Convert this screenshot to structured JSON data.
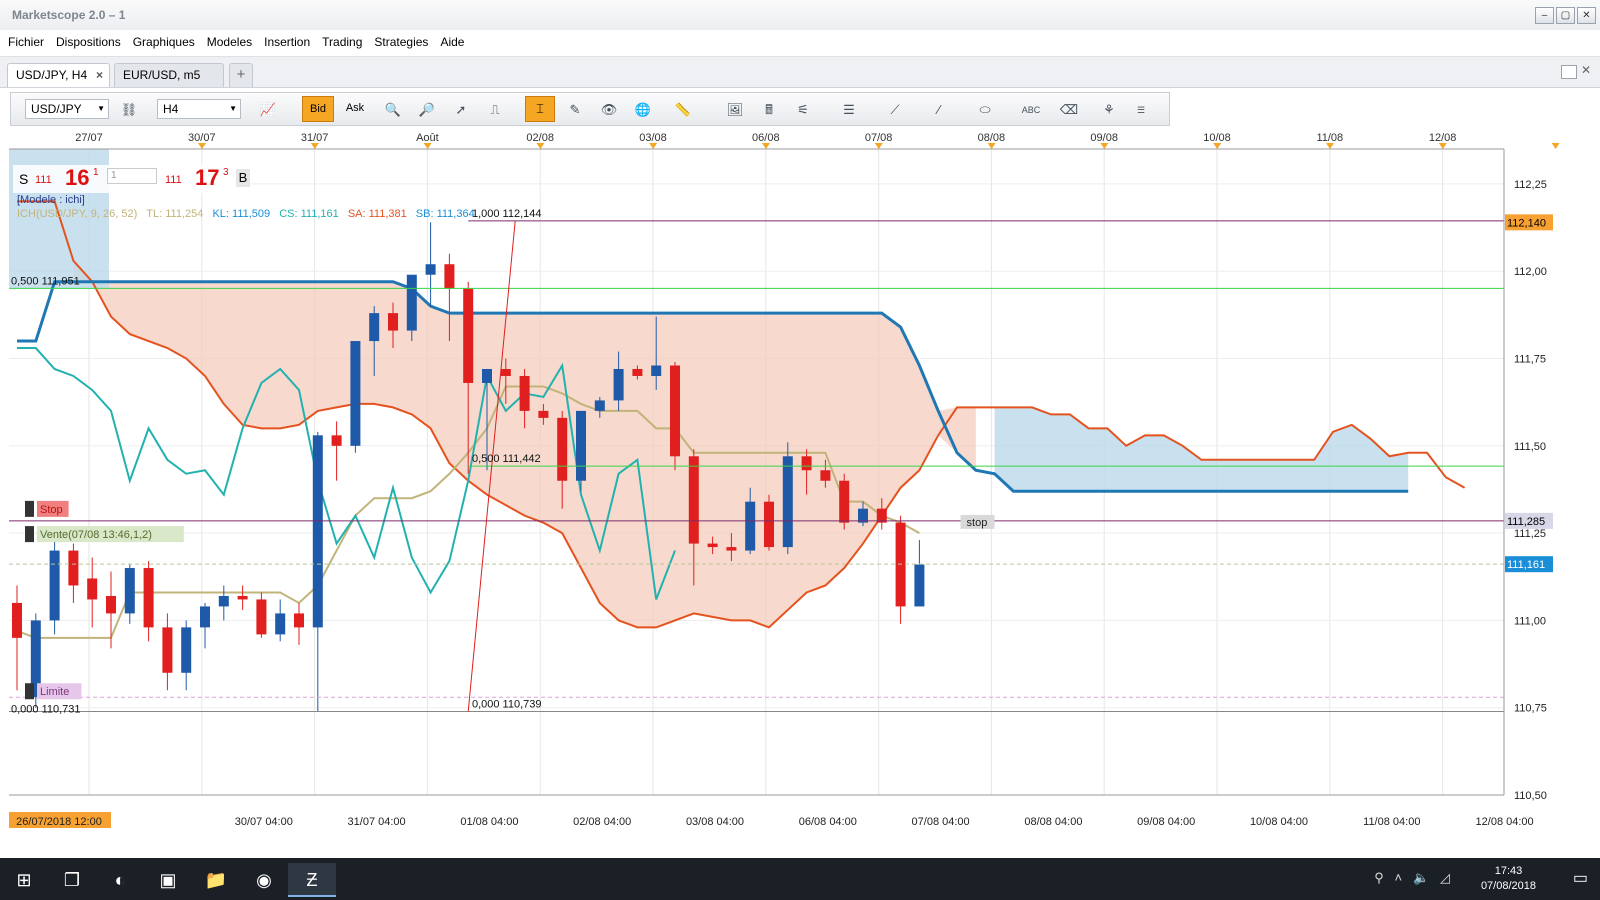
{
  "window": {
    "title": "Marketscope 2.0 – 1"
  },
  "menu": [
    "Fichier",
    "Dispositions",
    "Graphiques",
    "Modeles",
    "Insertion",
    "Trading",
    "Strategies",
    "Aide"
  ],
  "tabs": [
    {
      "label": "USD/JPY, H4",
      "active": true,
      "close": "×"
    },
    {
      "label": "EUR/USD, m5",
      "active": false
    }
  ],
  "add_tab": "+",
  "toolbar": {
    "instrument": "USD/JPY",
    "timeframe": "H4",
    "bid": "Bid",
    "ask": "Ask"
  },
  "quote": {
    "sell_label": "S",
    "sell_big": "111",
    "sell_pips": "16",
    "sell_frac": "1",
    "amount": "1",
    "buy_big": "111",
    "buy_pips": "17",
    "buy_frac": "3",
    "buy_label": "B"
  },
  "template_label": "[Modele : ichi]",
  "indicator": {
    "name": "ICH(USD/JPY, 9, 26, 52)",
    "tl": "TL: 111,254",
    "kl": "KL: 111,509",
    "cs": "CS: 111,161",
    "sa": "SA: 111,381",
    "sb": "SB: 111,364"
  },
  "date_axis_top": [
    "27/07",
    "30/07",
    "31/07",
    "Août",
    "02/08",
    "03/08",
    "06/08",
    "07/08",
    "08/08",
    "09/08",
    "10/08",
    "11/08",
    "12/08"
  ],
  "date_axis_bottom": [
    "26/07/2018 12:00",
    "30/07 04:00",
    "31/07 04:00",
    "01/08 04:00",
    "02/08 04:00",
    "03/08 04:00",
    "06/08 04:00",
    "07/08 04:00",
    "08/08 04:00",
    "09/08 04:00",
    "10/08 04:00",
    "11/08 04:00",
    "12/08 04:00"
  ],
  "price_axis": [
    "112,25",
    "112,00",
    "111,75",
    "111,50",
    "111,25",
    "111,00",
    "110,75",
    "110,50"
  ],
  "price_tags": [
    {
      "label": "112,140",
      "value": 112.14
    },
    {
      "label": "111,285",
      "value": 111.285
    },
    {
      "label": "111,161",
      "value": 111.161
    }
  ],
  "fib_labels": [
    "1,000 112,144",
    "0,500 111,442",
    "0,000 110,739",
    "0,500 111,951",
    "0,000 110,731"
  ],
  "order_labels": {
    "stop": "Stop",
    "vente": "Vente(07/08 13:46,1,2)",
    "limite": "Limite",
    "stop_small": "stop"
  },
  "colors": {
    "bull": "#1e5aa8",
    "bear": "#e11f1f",
    "kijun": "#1f77b4",
    "tenkan": "#c2b37a",
    "senkou_a": "#e4531f",
    "chikou": "#21b2b0",
    "cloud_bear": "#f4c9b8",
    "cloud_bull": "#bcd9ea",
    "fib_green": "#3ad44a",
    "fib_purple": "#7b2b6b",
    "tag_orange": "#f7a133",
    "tag_blue": "#1a8fd8"
  },
  "chart_data": {
    "type": "candlestick",
    "instrument": "USD/JPY",
    "timeframe": "H4",
    "ylim": [
      110.5,
      112.35
    ],
    "candles": [
      {
        "o": 111.05,
        "h": 111.1,
        "l": 110.8,
        "c": 110.95
      },
      {
        "o": 110.78,
        "h": 111.02,
        "l": 110.75,
        "c": 111.0
      },
      {
        "o": 111.0,
        "h": 111.23,
        "l": 110.96,
        "c": 111.2
      },
      {
        "o": 111.2,
        "h": 111.22,
        "l": 111.05,
        "c": 111.1
      },
      {
        "o": 111.12,
        "h": 111.18,
        "l": 110.98,
        "c": 111.06
      },
      {
        "o": 111.07,
        "h": 111.14,
        "l": 110.92,
        "c": 111.02
      },
      {
        "o": 111.02,
        "h": 111.16,
        "l": 110.99,
        "c": 111.15
      },
      {
        "o": 111.15,
        "h": 111.17,
        "l": 110.94,
        "c": 110.98
      },
      {
        "o": 110.98,
        "h": 111.02,
        "l": 110.8,
        "c": 110.85
      },
      {
        "o": 110.85,
        "h": 111.0,
        "l": 110.8,
        "c": 110.98
      },
      {
        "o": 110.98,
        "h": 111.05,
        "l": 110.92,
        "c": 111.04
      },
      {
        "o": 111.04,
        "h": 111.1,
        "l": 111.0,
        "c": 111.07
      },
      {
        "o": 111.07,
        "h": 111.1,
        "l": 111.03,
        "c": 111.06
      },
      {
        "o": 111.06,
        "h": 111.08,
        "l": 110.95,
        "c": 110.96
      },
      {
        "o": 110.96,
        "h": 111.06,
        "l": 110.94,
        "c": 111.02
      },
      {
        "o": 111.02,
        "h": 111.05,
        "l": 110.93,
        "c": 110.98
      },
      {
        "o": 110.98,
        "h": 111.54,
        "l": 110.74,
        "c": 111.53
      },
      {
        "o": 111.53,
        "h": 111.57,
        "l": 111.4,
        "c": 111.5
      },
      {
        "o": 111.5,
        "h": 111.62,
        "l": 111.48,
        "c": 111.8
      },
      {
        "o": 111.8,
        "h": 111.9,
        "l": 111.7,
        "c": 111.88
      },
      {
        "o": 111.88,
        "h": 111.91,
        "l": 111.78,
        "c": 111.83
      },
      {
        "o": 111.83,
        "h": 111.98,
        "l": 111.8,
        "c": 111.99
      },
      {
        "o": 111.99,
        "h": 112.14,
        "l": 111.9,
        "c": 112.02
      },
      {
        "o": 112.02,
        "h": 112.05,
        "l": 111.8,
        "c": 111.95
      },
      {
        "o": 111.95,
        "h": 111.97,
        "l": 111.42,
        "c": 111.68
      },
      {
        "o": 111.68,
        "h": 111.72,
        "l": 111.43,
        "c": 111.72
      },
      {
        "o": 111.72,
        "h": 111.75,
        "l": 111.62,
        "c": 111.7
      },
      {
        "o": 111.7,
        "h": 111.72,
        "l": 111.55,
        "c": 111.6
      },
      {
        "o": 111.6,
        "h": 111.62,
        "l": 111.56,
        "c": 111.58
      },
      {
        "o": 111.58,
        "h": 111.6,
        "l": 111.32,
        "c": 111.4
      },
      {
        "o": 111.4,
        "h": 111.55,
        "l": 111.37,
        "c": 111.6
      },
      {
        "o": 111.6,
        "h": 111.64,
        "l": 111.58,
        "c": 111.63
      },
      {
        "o": 111.63,
        "h": 111.77,
        "l": 111.6,
        "c": 111.72
      },
      {
        "o": 111.72,
        "h": 111.73,
        "l": 111.69,
        "c": 111.7
      },
      {
        "o": 111.7,
        "h": 111.87,
        "l": 111.66,
        "c": 111.73
      },
      {
        "o": 111.73,
        "h": 111.74,
        "l": 111.43,
        "c": 111.47
      },
      {
        "o": 111.47,
        "h": 111.49,
        "l": 111.1,
        "c": 111.22
      },
      {
        "o": 111.22,
        "h": 111.24,
        "l": 111.19,
        "c": 111.21
      },
      {
        "o": 111.21,
        "h": 111.25,
        "l": 111.17,
        "c": 111.2
      },
      {
        "o": 111.2,
        "h": 111.38,
        "l": 111.19,
        "c": 111.34
      },
      {
        "o": 111.34,
        "h": 111.36,
        "l": 111.2,
        "c": 111.21
      },
      {
        "o": 111.21,
        "h": 111.51,
        "l": 111.19,
        "c": 111.47
      },
      {
        "o": 111.47,
        "h": 111.49,
        "l": 111.36,
        "c": 111.43
      },
      {
        "o": 111.43,
        "h": 111.46,
        "l": 111.38,
        "c": 111.4
      },
      {
        "o": 111.4,
        "h": 111.42,
        "l": 111.26,
        "c": 111.28
      },
      {
        "o": 111.28,
        "h": 111.34,
        "l": 111.27,
        "c": 111.32
      },
      {
        "o": 111.32,
        "h": 111.35,
        "l": 111.26,
        "c": 111.28
      },
      {
        "o": 111.28,
        "h": 111.3,
        "l": 110.99,
        "c": 111.04
      },
      {
        "o": 111.04,
        "h": 111.23,
        "l": 111.04,
        "c": 111.16
      }
    ],
    "tenkan": [
      110.97,
      110.95,
      110.95,
      110.95,
      110.95,
      110.95,
      111.08,
      111.08,
      111.08,
      111.08,
      111.08,
      111.08,
      111.08,
      111.08,
      111.08,
      111.05,
      111.1,
      111.2,
      111.3,
      111.35,
      111.35,
      111.35,
      111.37,
      111.42,
      111.48,
      111.55,
      111.67,
      111.67,
      111.67,
      111.65,
      111.62,
      111.6,
      111.6,
      111.6,
      111.55,
      111.55,
      111.48,
      111.48,
      111.48,
      111.48,
      111.48,
      111.48,
      111.48,
      111.48,
      111.34,
      111.34,
      111.3,
      111.28,
      111.25
    ],
    "kijun": [
      111.8,
      111.8,
      111.97,
      111.97,
      111.97,
      111.97,
      111.97,
      111.97,
      111.97,
      111.97,
      111.97,
      111.97,
      111.97,
      111.97,
      111.97,
      111.97,
      111.97,
      111.97,
      111.97,
      111.97,
      111.97,
      111.95,
      111.9,
      111.88,
      111.88,
      111.88,
      111.88,
      111.88,
      111.88,
      111.88,
      111.88,
      111.88,
      111.88,
      111.88,
      111.88,
      111.88,
      111.88,
      111.88,
      111.88,
      111.88,
      111.88,
      111.88,
      111.88,
      111.88,
      111.88,
      111.88,
      111.88,
      111.84,
      111.73,
      111.6,
      111.48,
      111.43,
      111.42,
      111.37,
      111.37,
      111.37,
      111.37,
      111.37,
      111.37,
      111.37,
      111.37,
      111.37,
      111.37,
      111.37,
      111.37,
      111.37,
      111.37,
      111.37,
      111.37,
      111.37,
      111.37,
      111.37,
      111.37,
      111.37,
      111.37
    ],
    "senkou_a": [
      112.2,
      112.2,
      112.2,
      112.03,
      111.97,
      111.87,
      111.82,
      111.8,
      111.78,
      111.75,
      111.7,
      111.62,
      111.56,
      111.55,
      111.55,
      111.56,
      111.6,
      111.61,
      111.62,
      111.62,
      111.61,
      111.59,
      111.55,
      111.45,
      111.4,
      111.36,
      111.33,
      111.3,
      111.28,
      111.25,
      111.15,
      111.05,
      111.0,
      110.98,
      110.98,
      111.0,
      111.02,
      111.01,
      111.0,
      111.0,
      110.98,
      111.03,
      111.08,
      111.1,
      111.15,
      111.22,
      111.3,
      111.38,
      111.43,
      111.53,
      111.61,
      111.61,
      111.61,
      111.61,
      111.61,
      111.59,
      111.59,
      111.55,
      111.55,
      111.5,
      111.53,
      111.53,
      111.5,
      111.46,
      111.46,
      111.46,
      111.46,
      111.46,
      111.46,
      111.46,
      111.54,
      111.56,
      111.52,
      111.47,
      111.48,
      111.48,
      111.41,
      111.38
    ],
    "chikou": [
      111.78,
      111.78,
      111.72,
      111.7,
      111.66,
      111.6,
      111.4,
      111.55,
      111.46,
      111.42,
      111.43,
      111.36,
      111.55,
      111.68,
      111.72,
      111.66,
      111.4,
      111.22,
      111.3,
      111.18,
      111.38,
      111.18,
      111.08,
      111.17,
      111.4,
      111.7,
      111.6,
      111.65,
      111.64,
      111.73,
      111.36,
      111.2,
      111.42,
      111.46,
      111.06,
      111.2
    ],
    "current_price": 111.161
  }
}
